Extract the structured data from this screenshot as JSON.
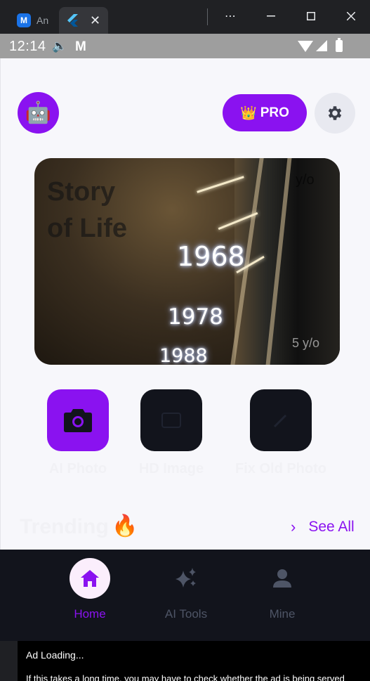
{
  "window": {
    "tabs": [
      {
        "title": "An",
        "icon": "app-logo-icon",
        "icon_glyph": "M"
      },
      {
        "title": "",
        "icon": "flutter-icon",
        "icon_glyph": "⚡",
        "close": "✕"
      }
    ],
    "controls": {
      "more": "⋯",
      "minimize": "—",
      "maximize": "☐",
      "close": "✕"
    }
  },
  "status_bar": {
    "time": "12:14",
    "icons": [
      "sound-icon",
      "gmail-icon",
      "wifi-icon",
      "cellular-icon",
      "battery-icon"
    ],
    "sound_glyph": "🔈",
    "mail_glyph": "M"
  },
  "header": {
    "avatar_glyph": "🤖",
    "pro_label": "PRO",
    "pro_glyph": "👑"
  },
  "banner": {
    "title_line1": "Story",
    "title_line2": "of Life",
    "years": [
      "1968",
      "1978",
      "1988"
    ],
    "age_top": "y/o",
    "age_bottom": "5 y/o"
  },
  "tools": [
    {
      "label": "AI Photo",
      "icon": "camera-icon",
      "active": true
    },
    {
      "label": "HD Image",
      "icon": "hd-image-icon",
      "active": false
    },
    {
      "label": "Fix Old Photo",
      "icon": "wand-icon",
      "active": false
    }
  ],
  "trending": {
    "title": "Trending",
    "fire_glyph": "🔥",
    "see_all": "See All",
    "chevron": "›"
  },
  "bottom_nav": [
    {
      "label": "Home",
      "icon": "home-icon",
      "active": true
    },
    {
      "label": "AI Tools",
      "icon": "sparkle-icon",
      "active": false
    },
    {
      "label": "Mine",
      "icon": "person-icon",
      "active": false
    }
  ],
  "ad": {
    "title": "Ad Loading...",
    "body": "If this takes a long time, you may have to check whether the ad is being served"
  },
  "colors": {
    "accent": "#8a12f0",
    "nav_bg": "#12141c",
    "app_bg": "#f7f7fb",
    "inactive": "#4e5566"
  }
}
